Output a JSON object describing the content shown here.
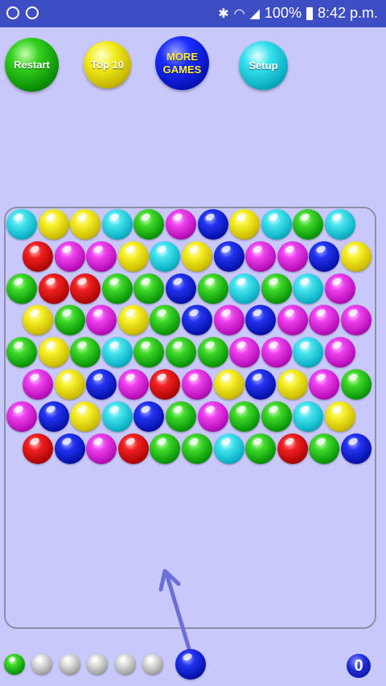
{
  "status_bar": {
    "battery": "100%",
    "time": "8:42 p.m."
  },
  "buttons": {
    "restart": "Restart",
    "top10": "Top 10",
    "more_games": "MORE\nGAMES",
    "setup": "Setup"
  },
  "grid": {
    "rows": [
      [
        "cyan",
        "yellow",
        "yellow",
        "cyan",
        "green",
        "magenta",
        "blue",
        "yellow",
        "cyan",
        "green",
        "cyan"
      ],
      [
        "red",
        "magenta",
        "magenta",
        "yellow",
        "cyan",
        "yellow",
        "blue",
        "magenta",
        "magenta",
        "blue",
        "yellow"
      ],
      [
        "green",
        "red",
        "red",
        "green",
        "green",
        "blue",
        "green",
        "cyan",
        "green",
        "cyan",
        "magenta"
      ],
      [
        "yellow",
        "green",
        "magenta",
        "yellow",
        "green",
        "blue",
        "magenta",
        "blue",
        "magenta",
        "magenta",
        "magenta"
      ],
      [
        "green",
        "yellow",
        "green",
        "cyan",
        "green",
        "green",
        "green",
        "magenta",
        "magenta",
        "cyan",
        "magenta"
      ],
      [
        "magenta",
        "yellow",
        "blue",
        "magenta",
        "red",
        "magenta",
        "yellow",
        "blue",
        "yellow",
        "magenta",
        "green"
      ],
      [
        "magenta",
        "blue",
        "yellow",
        "cyan",
        "blue",
        "green",
        "magenta",
        "green",
        "green",
        "cyan",
        "yellow"
      ],
      [
        "red",
        "blue",
        "magenta",
        "red",
        "green",
        "green",
        "cyan",
        "green",
        "red",
        "green",
        "blue"
      ]
    ]
  },
  "queue": {
    "next": "green",
    "remaining": [
      "silver",
      "silver",
      "silver",
      "silver",
      "silver"
    ],
    "current": "blue"
  },
  "score": "0"
}
